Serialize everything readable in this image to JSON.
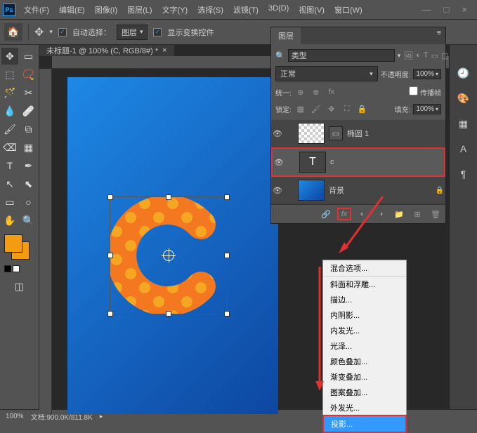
{
  "titlebar": {
    "menus": [
      "文件(F)",
      "编辑(E)",
      "图像(I)",
      "图层(L)",
      "文字(Y)",
      "选择(S)",
      "滤镜(T)",
      "3D(D)",
      "视图(V)",
      "窗口(W)"
    ]
  },
  "optionsbar": {
    "auto_select_label": "自动选择：",
    "target_label": "图层",
    "show_transform_label": "显示变换控件"
  },
  "doc_tab": {
    "title": "未标题-1 @ 100% (C, RGB/8#) *"
  },
  "layers_panel": {
    "tab_label": "图层",
    "search_placeholder": "类型",
    "blend_mode": "正常",
    "opacity_label": "不透明度:",
    "opacity_value": "100%",
    "unify_label": "统一:",
    "propagate_label": "传播帧",
    "lock_label": "锁定:",
    "fill_label": "填充:",
    "fill_value": "100%",
    "layers": [
      {
        "name": "椭圆 1",
        "type": "shape"
      },
      {
        "name": "c",
        "type": "text"
      },
      {
        "name": "背景",
        "type": "bg"
      }
    ],
    "fx_button": "fx"
  },
  "fx_menu": {
    "items": [
      "混合选项...",
      "斜面和浮雕...",
      "描边...",
      "内阴影...",
      "内发光...",
      "光泽...",
      "颜色叠加...",
      "渐变叠加...",
      "图案叠加...",
      "外发光...",
      "投影..."
    ],
    "highlighted_index": 10,
    "separator_after": 0
  },
  "statusbar": {
    "zoom": "100%",
    "doc_info": "文档:900.0K/811.8K"
  }
}
